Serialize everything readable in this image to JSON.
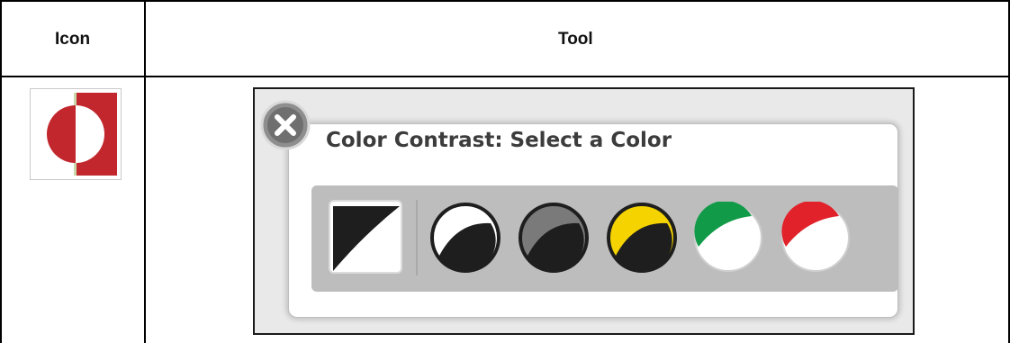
{
  "table": {
    "headers": {
      "icon": "Icon",
      "tool": "Tool"
    }
  },
  "icon_cell": {
    "icon": "color-contrast-icon"
  },
  "tool_dialog": {
    "title": "Color Contrast: Select a Color",
    "close_icon": "close-icon",
    "options": [
      {
        "name": "black-on-white",
        "fg": "#1e1e1e",
        "bg": "#ffffff"
      },
      {
        "name": "white-on-black",
        "fg": "#1e1e1e",
        "bg": "#ffffff"
      },
      {
        "name": "gray-on-black",
        "fg": "#1e1e1e",
        "bg": "#7a7a7a"
      },
      {
        "name": "yellow-on-black",
        "fg": "#1e1e1e",
        "bg": "#f4d300"
      },
      {
        "name": "green-on-white",
        "fg": "#ffffff",
        "bg": "#119a47"
      },
      {
        "name": "red-on-white",
        "fg": "#ffffff",
        "bg": "#e2222b"
      }
    ]
  }
}
